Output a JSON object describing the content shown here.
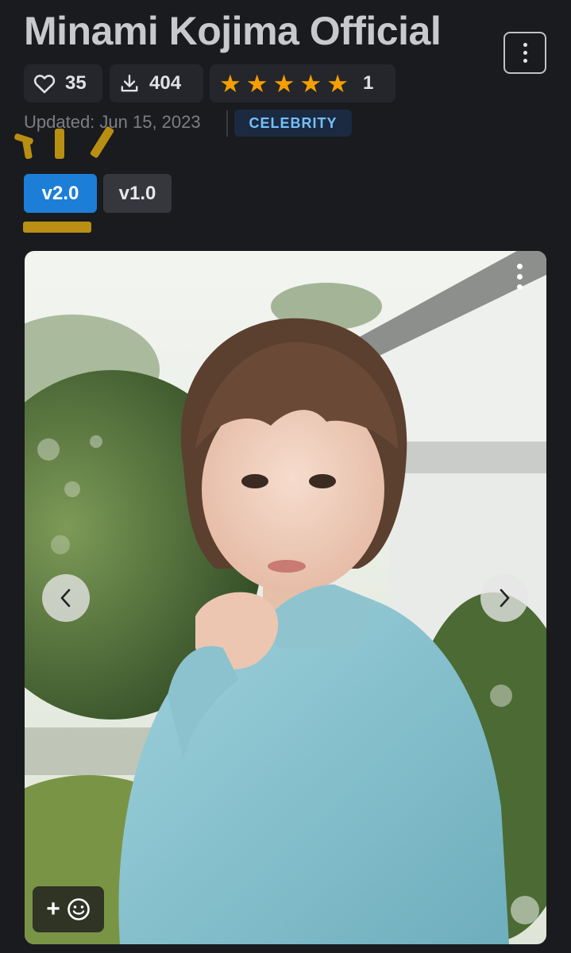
{
  "model": {
    "title": "Minami Kojima Official",
    "updated": "Updated: Jun 15, 2023",
    "category": "CELEBRITY"
  },
  "stats": {
    "likes": "35",
    "downloads": "404",
    "rating_stars": 5,
    "rating_count": "1"
  },
  "versions": [
    {
      "label": "v2.0",
      "active": true
    },
    {
      "label": "v1.0",
      "active": false
    }
  ],
  "icons": {
    "menu": "more-vertical-icon",
    "likes": "heart-icon",
    "downloads": "download-icon",
    "rating": "star-icon",
    "prev": "chevron-left-icon",
    "next": "chevron-right-icon",
    "reaction": "add-reaction-icon"
  },
  "colors": {
    "background": "#1a1b1e",
    "accent": "#1c7ed6",
    "star": "#f59f00",
    "badge_text": "#74c0fc",
    "badge_bg": "#1b2a40"
  }
}
